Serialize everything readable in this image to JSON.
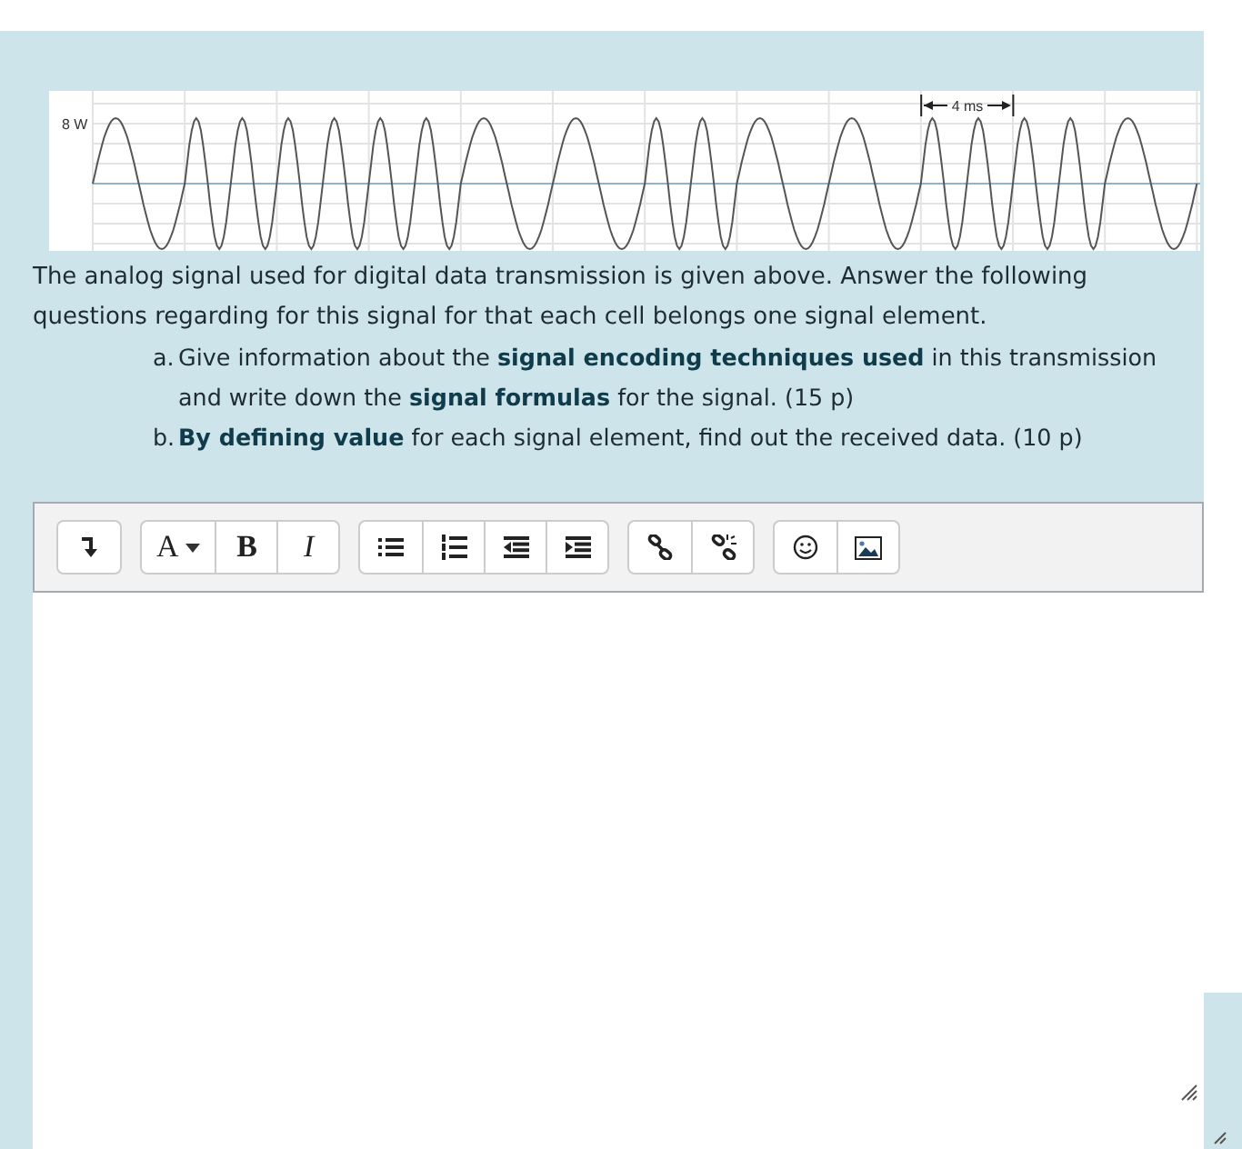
{
  "signal_figure": {
    "amplitude_label": "8 W",
    "duration_label": "4 ms"
  },
  "question": {
    "intro": "The analog signal used for digital data transmission is given above. Answer the following questions regarding for this signal for that each cell belongs one signal element.",
    "items": [
      {
        "marker": "a.",
        "text": "Give information about the **signal encoding techniques used** in this transmission and write down the **signal formulas** for the signal. (15 p)"
      },
      {
        "marker": "b.",
        "text": "**By defining value** for each signal element, find out the received data. (10 p)"
      }
    ]
  },
  "toolbar": {
    "groups": [
      [
        {
          "kind": "wrap"
        }
      ],
      [
        {
          "kind": "font",
          "label": "A"
        },
        {
          "kind": "bold",
          "label": "B"
        },
        {
          "kind": "italic",
          "label": "I"
        }
      ],
      [
        {
          "kind": "bullets"
        },
        {
          "kind": "numbers"
        },
        {
          "kind": "outdent"
        },
        {
          "kind": "indent"
        }
      ],
      [
        {
          "kind": "link"
        },
        {
          "kind": "unlink"
        }
      ],
      [
        {
          "kind": "emoji"
        },
        {
          "kind": "image"
        }
      ]
    ]
  }
}
